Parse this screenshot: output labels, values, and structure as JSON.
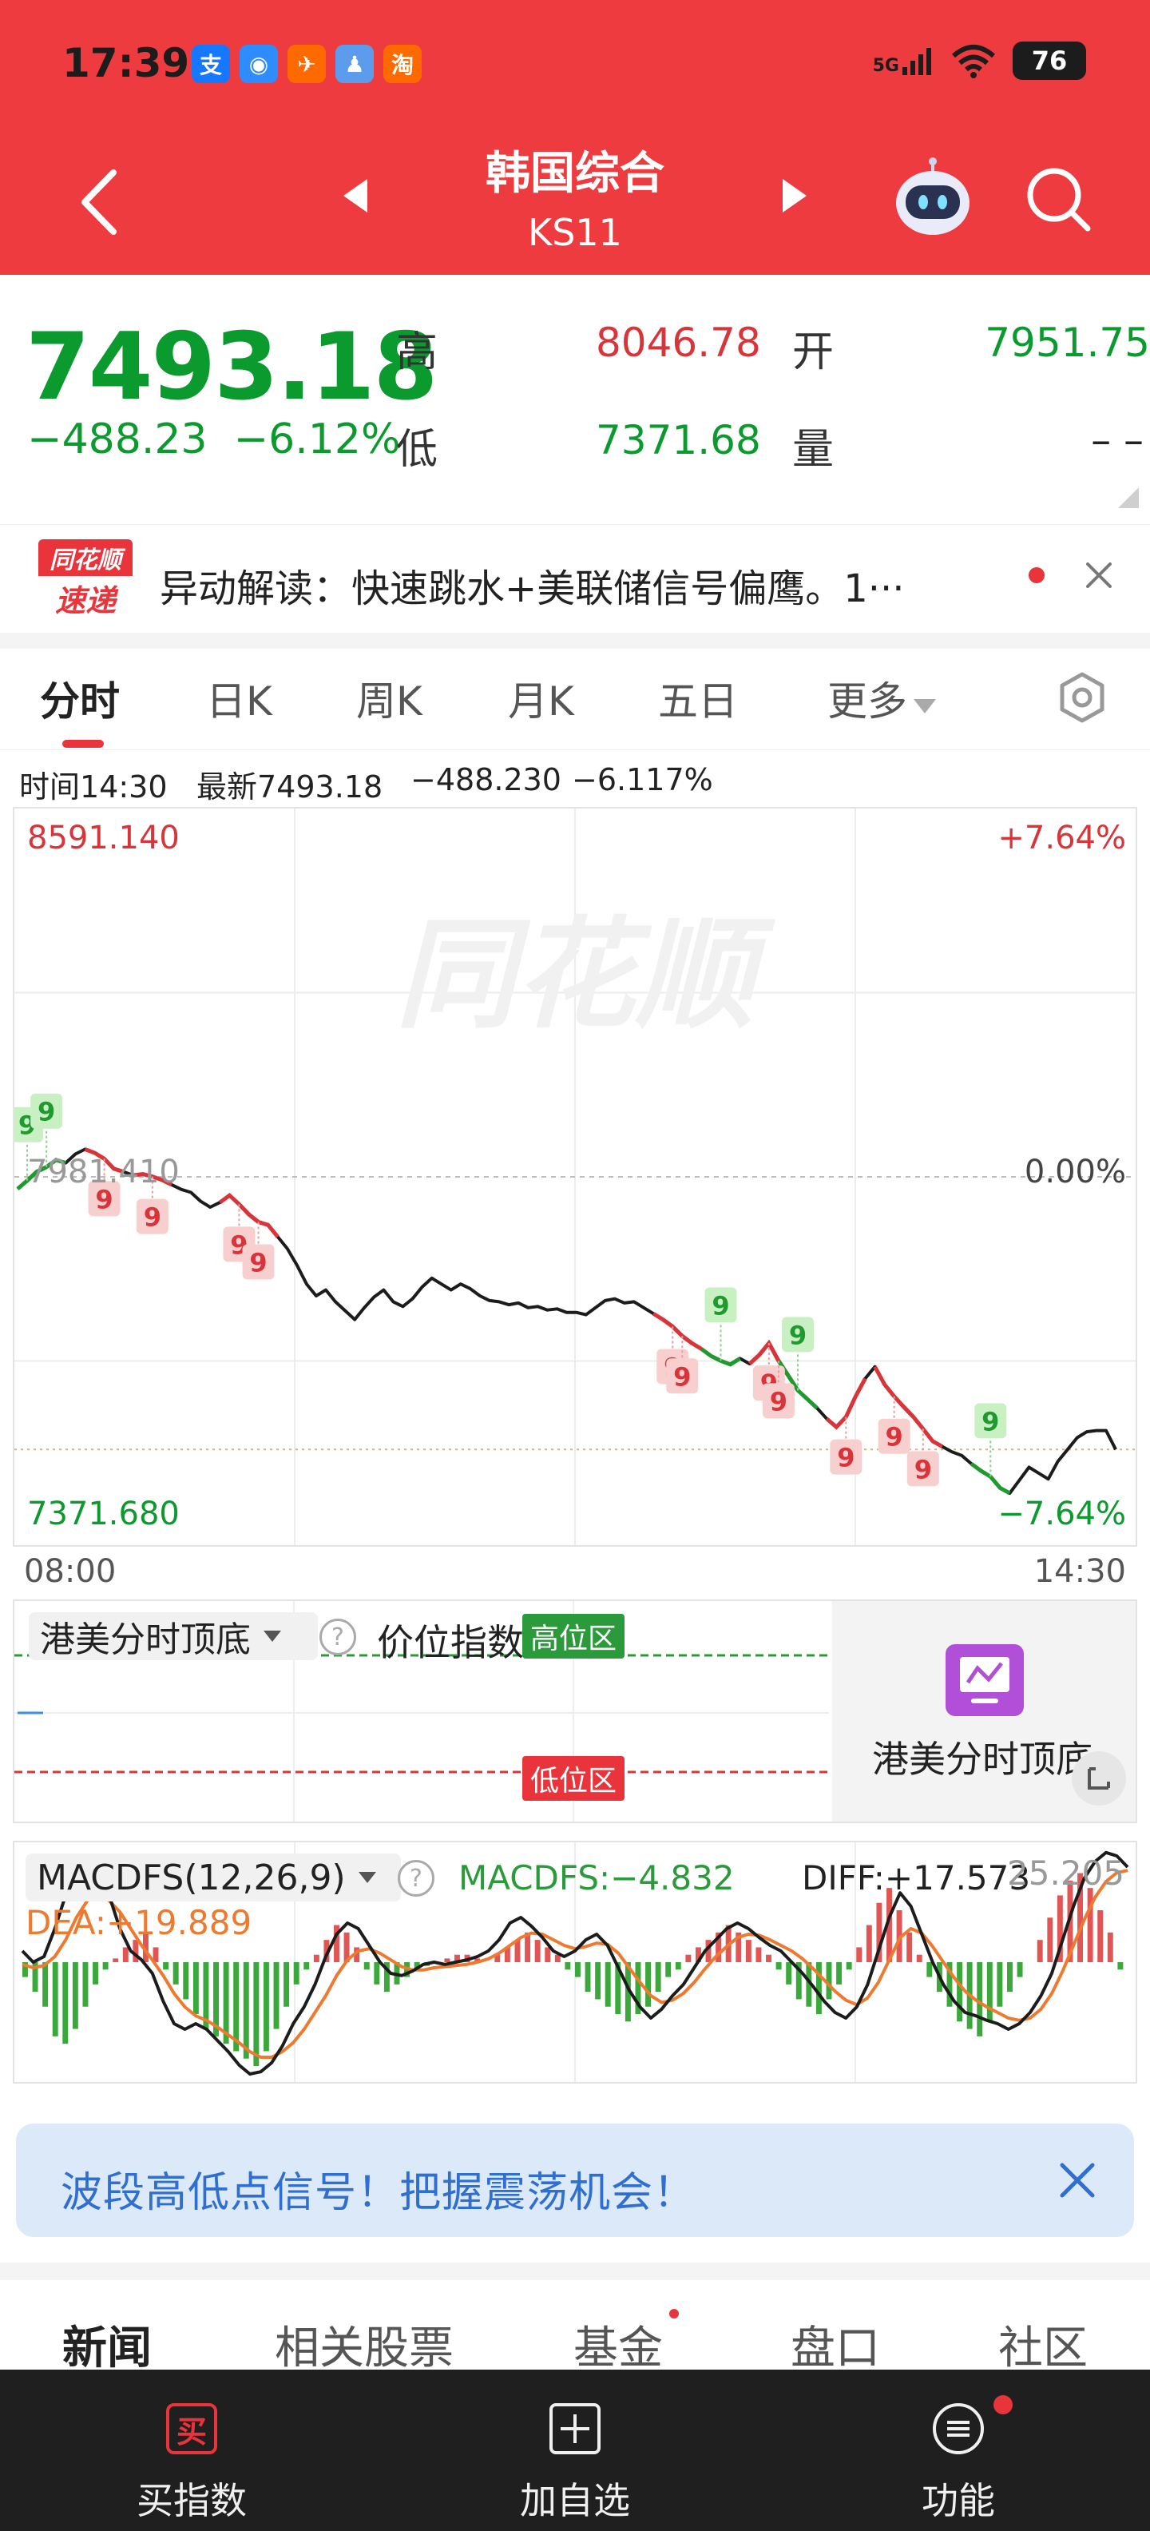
{
  "status_bar": {
    "time": "17:39",
    "apps": [
      {
        "label": "支",
        "color": "#1677ff"
      },
      {
        "label": "◉",
        "color": "#2f8cff"
      },
      {
        "label": "✈",
        "color": "#ff6a00"
      },
      {
        "label": "♟",
        "color": "#5d9cec"
      },
      {
        "label": "淘",
        "color": "#ff6a00"
      }
    ],
    "network": "5G",
    "battery": "76"
  },
  "header": {
    "title": "韩国综合",
    "code": "KS11"
  },
  "quote": {
    "price": "7493.18",
    "change": "−488.23",
    "change_pct": "−6.12%",
    "high_label": "高",
    "high": "8046.78",
    "open_label": "开",
    "open": "7951.75",
    "low_label": "低",
    "low": "7371.68",
    "volume_label": "量",
    "volume": "– –"
  },
  "news": {
    "logo_top": "同花顺",
    "logo_bottom": "速递",
    "text": "异动解读：快速跳水+美联储信号偏鹰。1···"
  },
  "tabs": [
    "分时",
    "日K",
    "周K",
    "月K",
    "五日"
  ],
  "tab_more": "更多",
  "info_line": {
    "time": "时间14:30",
    "latest": "最新7493.18",
    "change": "−488.230",
    "pct": "−6.117%"
  },
  "chart_data": {
    "type": "line",
    "title": "",
    "y_top_label": "8591.140",
    "y_top_pct": "+7.64%",
    "y_mid_label": "7981.410",
    "y_mid_pct": "0.00%",
    "y_bottom_label": "7371.680",
    "y_bottom_pct": "−7.64%",
    "x_start": "08:00",
    "x_end": "14:30",
    "ylim": [
      7371.68,
      8591.14
    ],
    "prev_close": 7981.41,
    "watermark": "同花顺",
    "series": [
      {
        "values": [
          7961,
          7975,
          7990,
          7998,
          8010,
          8005,
          8020,
          8028,
          8022,
          8012,
          7995,
          7990,
          7984,
          7986,
          7982,
          7976,
          7968,
          7960,
          7955,
          7940,
          7930,
          7938,
          7950,
          7935,
          7918,
          7905,
          7900,
          7880,
          7860,
          7832,
          7800,
          7780,
          7790,
          7770,
          7755,
          7740,
          7760,
          7778,
          7790,
          7770,
          7762,
          7775,
          7795,
          7810,
          7800,
          7790,
          7800,
          7792,
          7780,
          7772,
          7770,
          7765,
          7768,
          7760,
          7762,
          7756,
          7758,
          7752,
          7752,
          7748,
          7760,
          7772,
          7775,
          7768,
          7770,
          7760,
          7750,
          7740,
          7728,
          7712,
          7700,
          7690,
          7678,
          7670,
          7664,
          7674,
          7665,
          7680,
          7700,
          7670,
          7645,
          7620,
          7605,
          7590,
          7572,
          7558,
          7575,
          7610,
          7640,
          7660,
          7630,
          7610,
          7592,
          7575,
          7555,
          7534,
          7525,
          7516,
          7510,
          7496,
          7484,
          7474,
          7455,
          7446,
          7468,
          7490,
          7480,
          7470,
          7500,
          7520,
          7540,
          7550,
          7552,
          7552,
          7520
        ]
      }
    ],
    "signals": [
      {
        "idx": 1,
        "label": "9",
        "kind": "up"
      },
      {
        "idx": 3,
        "label": "9",
        "kind": "up"
      },
      {
        "idx": 9,
        "label": "9",
        "kind": "down"
      },
      {
        "idx": 14,
        "label": "9",
        "kind": "down"
      },
      {
        "idx": 23,
        "label": "9",
        "kind": "down"
      },
      {
        "idx": 25,
        "label": "9",
        "kind": "down"
      },
      {
        "idx": 68,
        "label": "9",
        "kind": "down"
      },
      {
        "idx": 69,
        "label": "9",
        "kind": "down"
      },
      {
        "idx": 73,
        "label": "9",
        "kind": "up"
      },
      {
        "idx": 78,
        "label": "9",
        "kind": "down"
      },
      {
        "idx": 79,
        "label": "9",
        "kind": "down"
      },
      {
        "idx": 81,
        "label": "9",
        "kind": "up"
      },
      {
        "idx": 86,
        "label": "9",
        "kind": "down"
      },
      {
        "idx": 91,
        "label": "9",
        "kind": "down"
      },
      {
        "idx": 94,
        "label": "9",
        "kind": "down"
      },
      {
        "idx": 101,
        "label": "9",
        "kind": "up"
      }
    ]
  },
  "indicator": {
    "selector": "港美分时顶底",
    "title": "价位指数",
    "high_zone": "高位区",
    "low_zone": "低位区",
    "promo_text": "港美分时顶底"
  },
  "macd": {
    "selector": "MACDFS(12,26,9)",
    "macdfs": "MACDFS:−4.832",
    "diff": "DIFF:+17.573",
    "dea": "DEA:+19.889",
    "max": "25.205",
    "histogram": [
      -4,
      -8,
      -12,
      -20,
      -22,
      -18,
      -12,
      -6,
      -2,
      1,
      4,
      6,
      8,
      4,
      -2,
      -6,
      -10,
      -14,
      -18,
      -20,
      -22,
      -24,
      -26,
      -28,
      -24,
      -18,
      -12,
      -6,
      -2,
      2,
      6,
      10,
      8,
      4,
      -2,
      -6,
      -8,
      -6,
      -4,
      -2,
      -1,
      0,
      1,
      2,
      2,
      1,
      0,
      2,
      4,
      6,
      8,
      6,
      4,
      2,
      -2,
      -4,
      -8,
      -10,
      -12,
      -14,
      -16,
      -14,
      -12,
      -8,
      -4,
      -2,
      2,
      4,
      6,
      8,
      10,
      8,
      6,
      4,
      2,
      -2,
      -6,
      -10,
      -12,
      -14,
      -10,
      -6,
      -2,
      4,
      10,
      16,
      20,
      14,
      8,
      2,
      -4,
      -8,
      -12,
      -16,
      -18,
      -20,
      -16,
      -12,
      -8,
      -4,
      0,
      6,
      12,
      18,
      22,
      24,
      20,
      14,
      8,
      -2
    ],
    "diff_line": [
      0.1,
      0.0,
      0.05,
      0.3,
      0.6,
      0.9,
      0.95,
      0.85,
      0.6,
      0.3,
      0.1,
      0.02,
      -0.1,
      -0.35,
      -0.55,
      -0.6,
      -0.55,
      -0.6,
      -0.7,
      -0.8,
      -0.92,
      -1.0,
      -0.98,
      -0.9,
      -0.75,
      -0.55,
      -0.4,
      -0.2,
      0.05,
      0.25,
      0.35,
      0.3,
      0.15,
      0.0,
      -0.1,
      -0.12,
      -0.08,
      -0.02,
      0.0,
      -0.02,
      0.0,
      0.02,
      0.05,
      0.1,
      0.2,
      0.35,
      0.4,
      0.32,
      0.22,
      0.1,
      0.05,
      0.1,
      0.2,
      0.25,
      0.15,
      -0.05,
      -0.25,
      -0.4,
      -0.5,
      -0.42,
      -0.3,
      -0.2,
      -0.05,
      0.1,
      0.2,
      0.3,
      0.35,
      0.3,
      0.22,
      0.15,
      0.1,
      0.0,
      -0.1,
      -0.22,
      -0.35,
      -0.45,
      -0.5,
      -0.4,
      -0.2,
      0.1,
      0.4,
      0.62,
      0.5,
      0.25,
      0.0,
      -0.2,
      -0.35,
      -0.45,
      -0.48,
      -0.52,
      -0.55,
      -0.6,
      -0.55,
      -0.45,
      -0.3,
      -0.1,
      0.2,
      0.5,
      0.75,
      0.9,
      0.98,
      0.95,
      0.85
    ],
    "dea_line": [
      -0.02,
      -0.05,
      -0.03,
      0.05,
      0.2,
      0.4,
      0.55,
      0.6,
      0.55,
      0.45,
      0.3,
      0.15,
      0.02,
      -0.12,
      -0.28,
      -0.4,
      -0.48,
      -0.52,
      -0.58,
      -0.65,
      -0.72,
      -0.8,
      -0.85,
      -0.85,
      -0.8,
      -0.72,
      -0.6,
      -0.45,
      -0.3,
      -0.12,
      0.02,
      0.1,
      0.12,
      0.08,
      0.02,
      -0.04,
      -0.07,
      -0.07,
      -0.05,
      -0.04,
      -0.03,
      -0.02,
      0.0,
      0.03,
      0.08,
      0.15,
      0.22,
      0.26,
      0.25,
      0.2,
      0.15,
      0.12,
      0.14,
      0.17,
      0.16,
      0.08,
      -0.05,
      -0.18,
      -0.3,
      -0.36,
      -0.34,
      -0.28,
      -0.18,
      -0.06,
      0.05,
      0.14,
      0.22,
      0.25,
      0.24,
      0.2,
      0.15,
      0.1,
      0.03,
      -0.06,
      -0.16,
      -0.26,
      -0.34,
      -0.38,
      -0.32,
      -0.18,
      0.02,
      0.22,
      0.3,
      0.26,
      0.14,
      0.0,
      -0.14,
      -0.26,
      -0.34,
      -0.4,
      -0.45,
      -0.5,
      -0.52,
      -0.5,
      -0.42,
      -0.28,
      -0.08,
      0.15,
      0.38,
      0.58,
      0.72,
      0.8,
      0.82
    ]
  },
  "banner": {
    "text": "波段高低点信号！把握震荡机会！"
  },
  "bottom_tabs": [
    "新闻",
    "相关股票",
    "基金",
    "盘口",
    "社区"
  ],
  "bottom_bar": {
    "buy_icon_char": "买",
    "buy_label": "买指数",
    "add_label": "加自选",
    "func_label": "功能"
  },
  "colors": {
    "brand_red": "#ee3b3f",
    "up_red": "#d9343a",
    "down_green": "#0a9a2e",
    "diff_line": "#1c1c1c",
    "dea_line": "#ee7a2f",
    "banner_blue": "#2f6fd1"
  }
}
